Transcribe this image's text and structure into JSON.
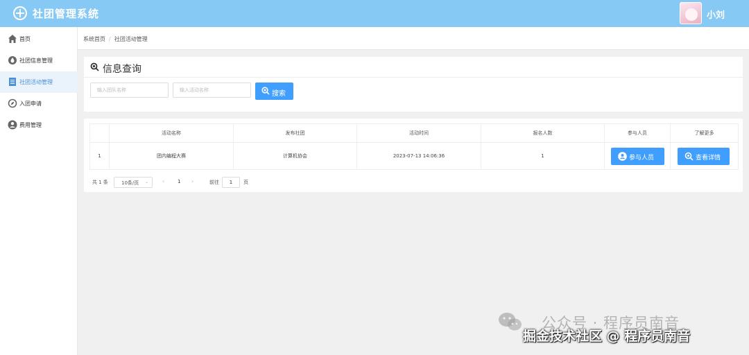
{
  "header": {
    "app_title": "社团管理系统",
    "user_name": "小刘"
  },
  "sidebar": {
    "items": [
      {
        "label": "首页",
        "icon": "home-icon",
        "active": false
      },
      {
        "label": "社团信息管理",
        "icon": "droplet-icon",
        "active": false
      },
      {
        "label": "社团活动管理",
        "icon": "document-icon",
        "active": true
      },
      {
        "label": "入团申请",
        "icon": "compass-icon",
        "active": false
      },
      {
        "label": "费用管理",
        "icon": "user-icon",
        "active": false
      }
    ]
  },
  "breadcrumb": {
    "home": "系统首页",
    "separator": "/",
    "current": "社团活动管理"
  },
  "search": {
    "title": "信息查询",
    "team_placeholder": "输入团队名称",
    "activity_placeholder": "输入活动名称",
    "button_label": "搜索"
  },
  "table": {
    "columns": [
      "",
      "活动名称",
      "发布社团",
      "活动时间",
      "报名人数",
      "参与人员",
      "了解更多"
    ],
    "rows": [
      {
        "index": "1",
        "activity_name": "团内编程大赛",
        "club": "计算机协会",
        "time": "2023-07-13 14:06:36",
        "signups": "1",
        "participants_btn": "参与人员",
        "details_btn": "查看详情"
      }
    ]
  },
  "pagination": {
    "total": "共 1 条",
    "page_size": "10条/页",
    "current_page": "1",
    "goto_label": "前往",
    "goto_value": "1",
    "goto_unit": "页"
  },
  "watermark": {
    "line1": "公众号 · 程序员南音",
    "line2": "掘金技术社区 @ 程序员南音"
  },
  "colors": {
    "header_bg": "#87c9f5",
    "primary": "#409eff",
    "active_bg": "#eaf3fb",
    "page_bg": "#f0f0f0"
  }
}
